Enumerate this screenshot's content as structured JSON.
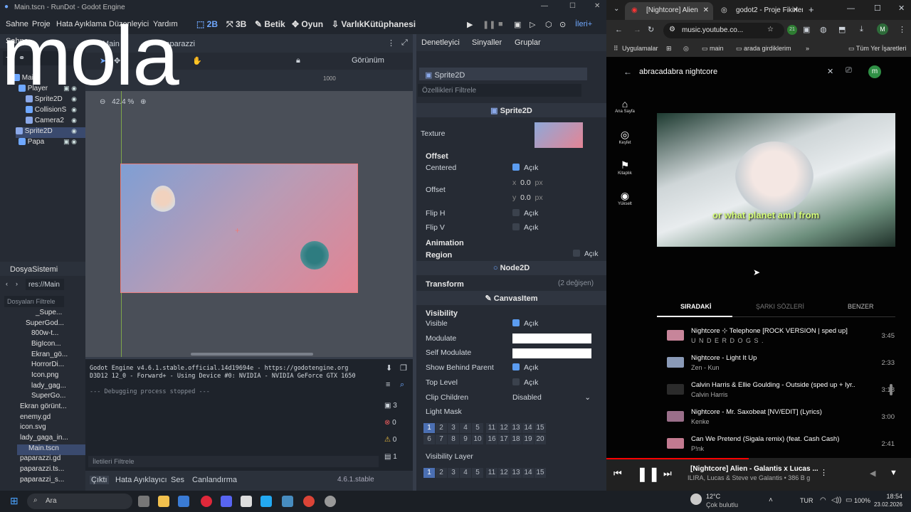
{
  "godot": {
    "window_title": "Main.tscn - RunDot - Godot Engine",
    "menu": [
      "Sahne",
      "Proje",
      "Hata Ayıklama",
      "Düzenleyici",
      "Yardım"
    ],
    "workspaces": [
      "2B",
      "3B",
      "Betik",
      "Oyun",
      "VarlıkKütüphanesi"
    ],
    "renderer": "İleri+",
    "scene_tabs": [
      "Main",
      "Paparazzi"
    ],
    "scene_dock_tabs": [
      "Sahne",
      "İçe Aktar"
    ],
    "tree": [
      {
        "label": "Main",
        "type": "node2d"
      },
      {
        "label": "Player",
        "type": "body"
      },
      {
        "label": "Sprite2D",
        "type": "sprite"
      },
      {
        "label": "CollisionS",
        "type": "collision"
      },
      {
        "label": "Camera2",
        "type": "camera"
      },
      {
        "label": "Sprite2D",
        "type": "sprite"
      },
      {
        "label": "Papa",
        "type": "body"
      }
    ],
    "viewport": {
      "zoom": "42.4 %",
      "view_menu": "Görünüm",
      "ruler_mark": "1000",
      "node_label": "Sprite2D"
    },
    "filesystem": {
      "title": "DosyaSistemi",
      "path": "res://Main",
      "filter_placeholder": "Dosyaları Filtrele",
      "files": [
        "_Supe...",
        "SuperGod...",
        "800w-t...",
        "BigIcon...",
        "Ekran_gö...",
        "HorrorDi...",
        "Icon.png",
        "lady_gag...",
        "SuperGo...",
        "Ekran görünt...",
        "enemy.gd",
        "icon.svg",
        "lady_gaga_in...",
        "Main.tscn",
        "paparazzi.gd",
        "paparazzi.ts...",
        "paparazzi_s..."
      ]
    },
    "output": {
      "lines": [
        "Godot Engine v4.6.1.stable.official.14d19694e - https://godotengine.org",
        "D3D12 12_0 - Forward+ - Using Device #0: NVIDIA - NVIDIA GeForce GTX 1650",
        "",
        "--- Debugging process stopped ---"
      ],
      "filter_placeholder": "İletileri Filtrele",
      "counts": [
        "3",
        "0",
        "0",
        "1"
      ],
      "bottom_tabs": [
        "Çıktı",
        "Hata Ayıklayıcı",
        "Ses",
        "Canlandırma"
      ],
      "version": "4.6.1.stable"
    },
    "inspector": {
      "tabs": [
        "Denetleyici",
        "Sinyaller",
        "Gruplar"
      ],
      "node": "Sprite2D",
      "filter_placeholder": "Özellikleri Filtrele",
      "class_sprite": "Sprite2D",
      "texture_label": "Texture",
      "offset_section": "Offset",
      "centered": "Centered",
      "on_text": "Açık",
      "offset": "Offset",
      "offset_x": "0.0",
      "offset_y": "0.0",
      "px": "px",
      "x": "x",
      "y": "y",
      "flip_h": "Flip H",
      "flip_v": "Flip V",
      "animation": "Animation",
      "region": "Region",
      "class_node2d": "Node2D",
      "transform": "Transform",
      "transform_changes": "(2 değişen)",
      "class_canvasitem": "CanvasItem",
      "visibility": "Visibility",
      "visible": "Visible",
      "modulate": "Modulate",
      "self_modulate": "Self Modulate",
      "show_behind_parent": "Show Behind Parent",
      "top_level": "Top Level",
      "clip_children": "Clip Children",
      "clip_value": "Disabled",
      "light_mask": "Light Mask",
      "visibility_layer": "Visibility Layer",
      "layers_row1": [
        "1",
        "2",
        "3",
        "4",
        "5",
        "11",
        "12",
        "13",
        "14",
        "15"
      ],
      "layers_row2": [
        "6",
        "7",
        "8",
        "9",
        "10",
        "16",
        "17",
        "18",
        "19",
        "20"
      ]
    }
  },
  "overlay_text": "mola",
  "browser": {
    "tabs": [
      "[Nightcore] Alien",
      "godot2 - Proje Fikirler"
    ],
    "url": "music.youtube.co...",
    "bookmarks": [
      "Uygulamalar",
      "main",
      "arada girdiklerim",
      "Tüm Yer İşaretleri"
    ],
    "search_query": "abracadabra nightcore",
    "avatar_letter": "m",
    "nav": [
      {
        "label": "Ana Sayfa",
        "icon": "home-icon"
      },
      {
        "label": "Keşfet",
        "icon": "compass-icon"
      },
      {
        "label": "Kitaplık",
        "icon": "library-icon"
      },
      {
        "label": "Yükselt",
        "icon": "upgrade-icon"
      }
    ],
    "video_caption": "or what planet am I from",
    "tabs_row": [
      "SIRADAKİ",
      "ŞARKI SÖZLERİ",
      "BENZER"
    ],
    "queue": [
      {
        "title": "Nightcore ⊹ Telephone [ROCK VERSION | sped up]",
        "artist": "U N D E R D O G S .",
        "duration": "3:45",
        "color": "#c7859a"
      },
      {
        "title": "Nightcore - Light It Up",
        "artist": "Zen - Kun",
        "duration": "2:33",
        "color": "#8a9ab7"
      },
      {
        "title": "Calvin Harris & Ellie Goulding - Outside (sped up + lyr...",
        "artist": "Calvin Harris",
        "duration": "3:18",
        "color": "#2b2b2b"
      },
      {
        "title": "Nightcore - Mr. Saxobeat [NV/EDIT] (Lyrics)",
        "artist": "Kenke",
        "duration": "3:00",
        "color": "#9a6f8a"
      },
      {
        "title": "Can We Pretend (Sigala remix) (feat. Cash Cash)",
        "artist": "P!nk",
        "duration": "2:41",
        "color": "#c27a90"
      }
    ],
    "player": {
      "title": "[Nightcore] Alien - Galantis x Lucas ...",
      "subtitle": "ILIRA, Lucas & Steve ve Galantis • 386 B g"
    }
  },
  "taskbar": {
    "search_placeholder": "Ara",
    "weather_temp": "12°C",
    "weather_text": "Çok bulutlu",
    "lang": "TUR",
    "battery": "100%",
    "time": "18:54",
    "date": "23.02.2026"
  },
  "colors": {
    "accent": "#6fa8ff",
    "godot_bg": "#363d4a",
    "yt_bg": "#030303",
    "yt_red": "#ff0000"
  }
}
